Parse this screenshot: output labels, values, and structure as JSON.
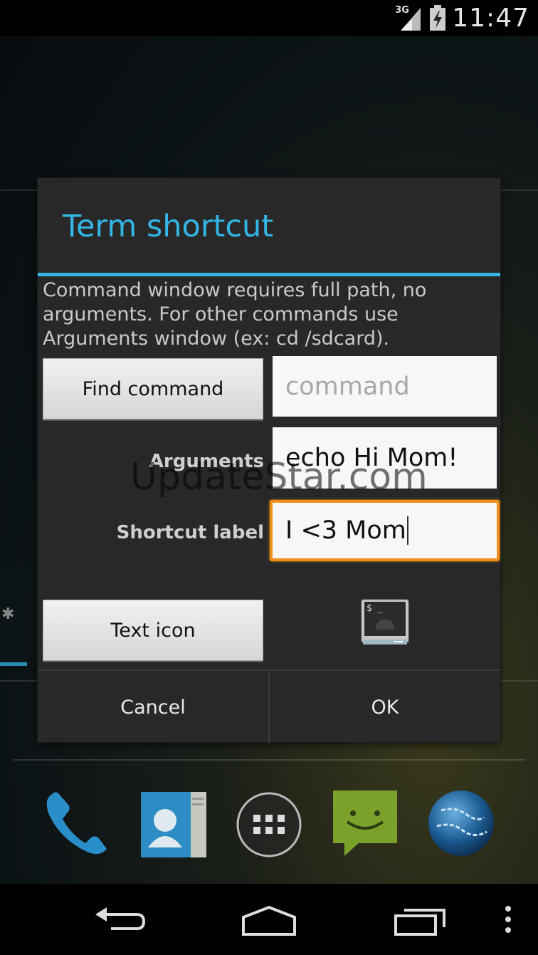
{
  "status_bar": {
    "network": "3G",
    "time": "11:47"
  },
  "dialog": {
    "title": "Term shortcut",
    "description": "Command window requires full path, no arguments. For other commands use Arguments window (ex: cd /sdcard).",
    "find_command_label": "Find command",
    "command_placeholder": "command",
    "arguments_label": "Arguments",
    "arguments_value": "echo Hi Mom!",
    "shortcut_label_label": "Shortcut label",
    "shortcut_label_value": "I <3 Mom",
    "text_icon_label": "Text icon",
    "cancel_label": "Cancel",
    "ok_label": "OK"
  },
  "watermark": "UpdateStar.com",
  "dock": {
    "icons": [
      "phone-icon",
      "contacts-icon",
      "app-drawer-icon",
      "messaging-icon",
      "browser-icon"
    ]
  },
  "navbar": {
    "icons": [
      "back-icon",
      "home-icon",
      "recent-apps-icon",
      "overflow-menu-icon"
    ]
  },
  "colors": {
    "accent": "#33b5e5",
    "focus": "#f0901a",
    "dialog_bg": "#282828"
  }
}
